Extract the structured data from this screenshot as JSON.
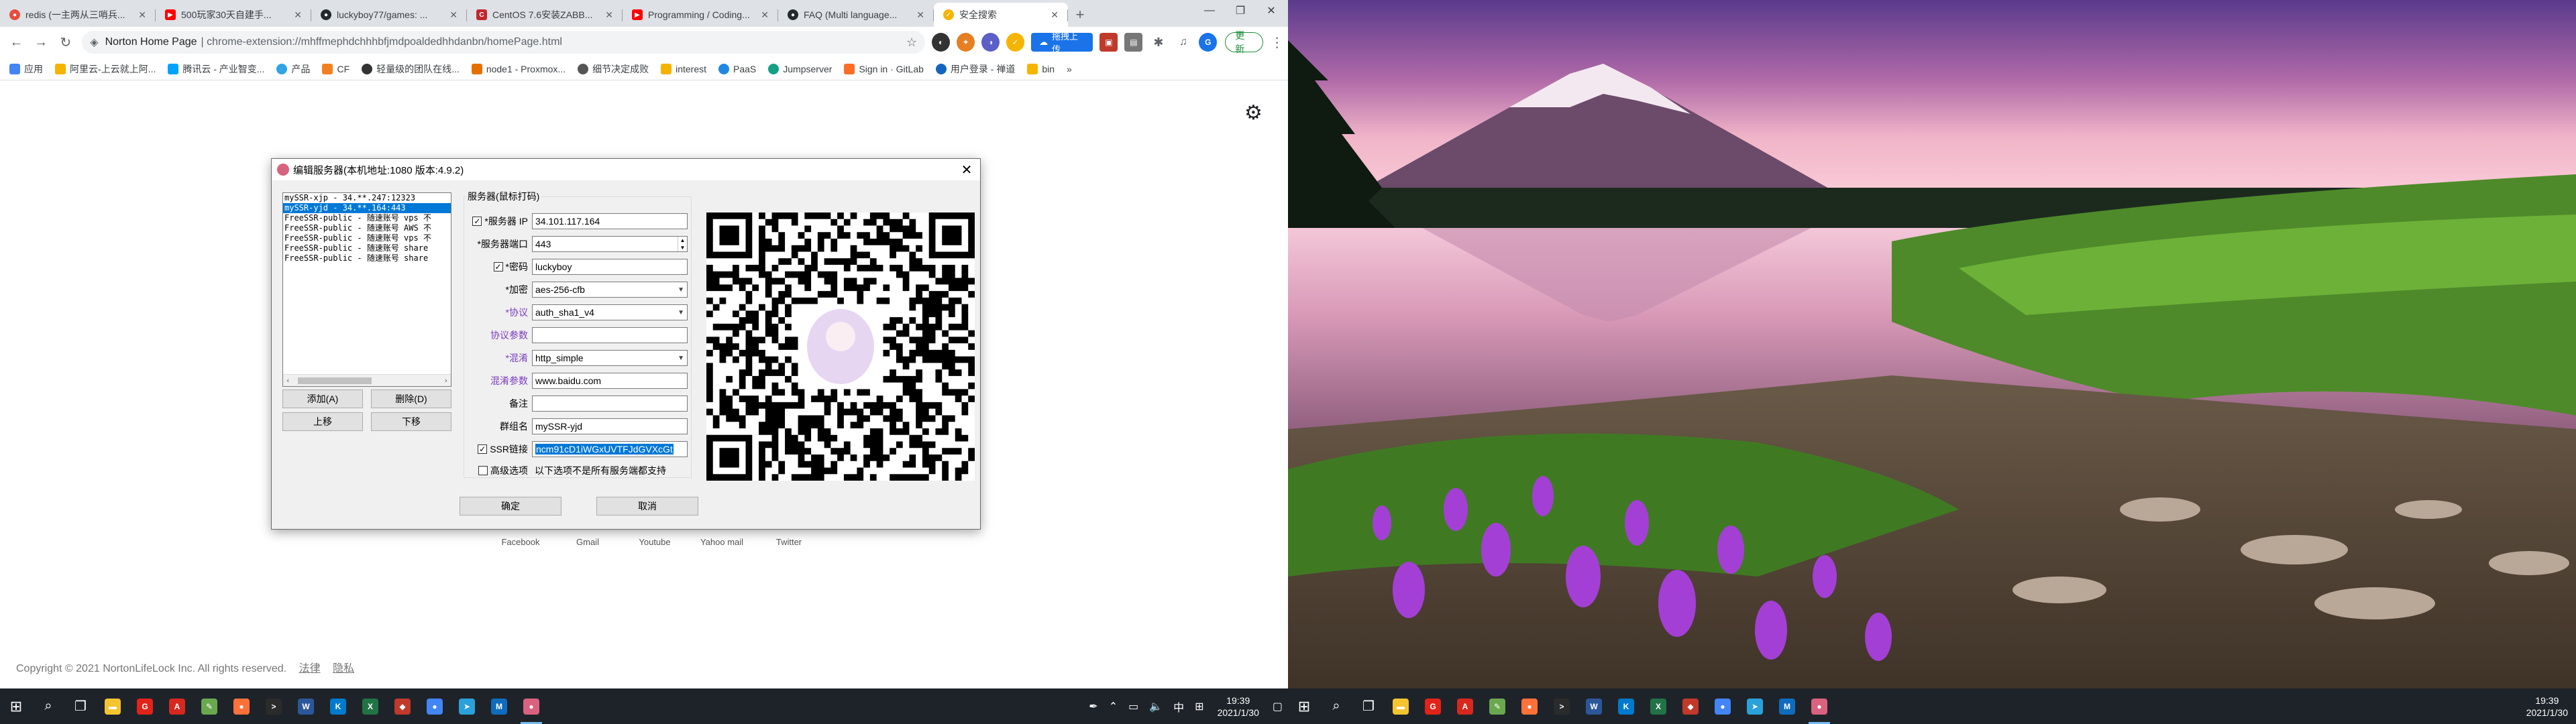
{
  "browser": {
    "tabs": [
      {
        "title": "redis (一主两从三哨兵...",
        "color": "#e74c3c"
      },
      {
        "title": "500玩家30天自建手...",
        "color": "#ff0000"
      },
      {
        "title": "luckyboy77/games: ...",
        "color": "#24292e"
      },
      {
        "title": "CentOS 7.6安装ZABB...",
        "color": "#c1272d"
      },
      {
        "title": "Programming / Coding...",
        "color": "#ff0000"
      },
      {
        "title": "FAQ (Multi language...",
        "color": "#24292e"
      },
      {
        "title": "安全搜索",
        "color": "#f5b400"
      }
    ],
    "site": "Norton Home Page",
    "url": "chrome-extension://mhffmephdchhhbfjmdpoaldedhhdanbn/homePage.html",
    "ext_pill": "拖拽上传",
    "update_label": "更新",
    "bookmarks": [
      "应用",
      "阿里云-上云就上阿...",
      "腾讯云 - 产业智变...",
      "产品",
      "CF",
      "轻量级的团队在线...",
      "node1 - Proxmox...",
      "细节决定成败",
      "interest",
      "PaaS",
      "Jumpserver",
      "Sign in · GitLab",
      "用户登录 - 禅道",
      "bin"
    ],
    "bookmarks_more": "»"
  },
  "page": {
    "social": [
      "Facebook",
      "Gmail",
      "Youtube",
      "Yahoo mail",
      "Twitter"
    ],
    "copyright": "Copyright © 2021 NortonLifeLock Inc. All rights reserved.",
    "legal": "法律",
    "privacy": "隐私"
  },
  "dialog": {
    "title": "编辑服务器(本机地址:1080 版本:4.9.2)",
    "servers": [
      "mySSR-xjp - 34.**.247:12323",
      "mySSR-yjd - 34.**.164:443",
      "FreeSSR-public - 随速账号 vps 不",
      "FreeSSR-public - 随速账号 AWS 不",
      "FreeSSR-public - 随速账号 vps 不",
      "FreeSSR-public - 随速账号 share",
      "FreeSSR-public - 随速账号 share"
    ],
    "selected_index": 1,
    "buttons": {
      "add": "添加(A)",
      "delete": "删除(D)",
      "up": "上移",
      "down": "下移",
      "ok": "确定",
      "cancel": "取消"
    },
    "group_title": "服务器(鼠标打码)",
    "fields": {
      "server_ip_label": "*服务器 IP",
      "server_ip": "34.101.117.164",
      "port_label": "*服务器端口",
      "port": "443",
      "password_label": "*密码",
      "password": "luckyboy",
      "encrypt_label": "*加密",
      "encrypt": "aes-256-cfb",
      "protocol_label": "*协议",
      "protocol": "auth_sha1_v4",
      "protocol_param_label": "协议参数",
      "protocol_param": "",
      "obfs_label": "*混淆",
      "obfs": "http_simple",
      "obfs_param_label": "混淆参数",
      "obfs_param": "www.baidu.com",
      "remark_label": "备注",
      "remark": "",
      "group_label": "群组名",
      "group": "mySSR-yjd",
      "ssr_link_label": "SSR链接",
      "ssr_link": "ncm91cD1iWGxUVTFJdGVXcGt",
      "advanced_label": "高级选项",
      "advanced_note": "以下选项不是所有服务端都支持"
    },
    "checks": {
      "server_ip": true,
      "password": true,
      "ssr_link": true,
      "advanced": false
    }
  },
  "taskbar_left": {
    "apps": [
      {
        "icon": "file-explorer-icon",
        "color": "#f4c430",
        "glyph": "▬"
      },
      {
        "icon": "app-red-icon",
        "color": "#e2231a",
        "glyph": "G"
      },
      {
        "icon": "acrobat-icon",
        "color": "#d7281e",
        "glyph": "A"
      },
      {
        "icon": "notepad-icon",
        "color": "#6aa84f",
        "glyph": "✎"
      },
      {
        "icon": "firefox-icon",
        "color": "#ff7139",
        "glyph": "●"
      },
      {
        "icon": "terminal-icon",
        "color": "#2b2b2b",
        "glyph": ">"
      },
      {
        "icon": "word-icon",
        "color": "#2b579a",
        "glyph": "W"
      },
      {
        "icon": "vscode-icon",
        "color": "#007acc",
        "glyph": "K"
      },
      {
        "icon": "excel-icon",
        "color": "#217346",
        "glyph": "X"
      },
      {
        "icon": "paw-icon",
        "color": "#c0392b",
        "glyph": "◆"
      },
      {
        "icon": "chrome-icon",
        "color": "#4285f4",
        "glyph": "●"
      },
      {
        "icon": "telegram-icon",
        "color": "#2aa1da",
        "glyph": "➤"
      },
      {
        "icon": "mail-icon",
        "color": "#0f6cbd",
        "glyph": "M"
      },
      {
        "icon": "ssr-icon",
        "color": "#d9627f",
        "glyph": "●"
      }
    ],
    "ime": "中",
    "time": "19:39",
    "date": "2021/1/30"
  },
  "taskbar_right": {
    "time": "19:39",
    "date": "2021/1/30"
  }
}
